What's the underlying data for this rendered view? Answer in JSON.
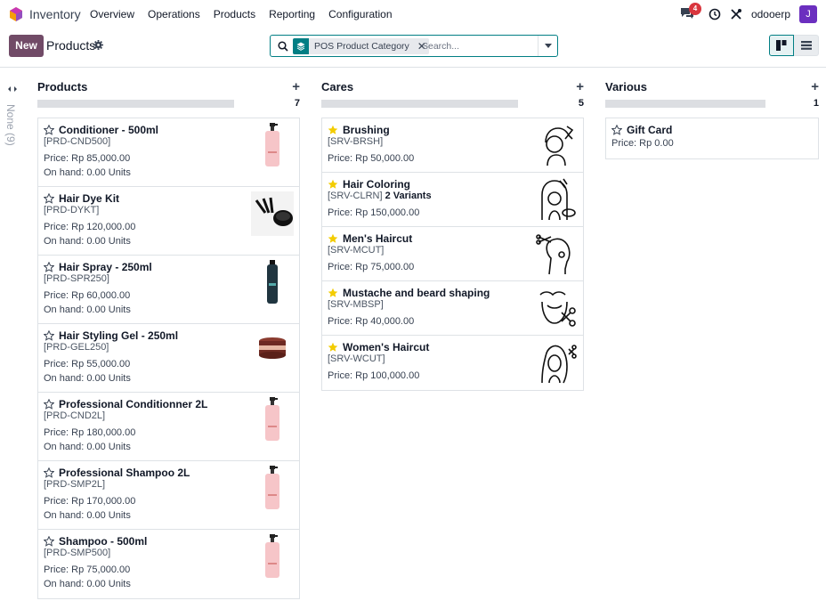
{
  "nav": {
    "app_name": "Inventory",
    "menu": [
      "Overview",
      "Operations",
      "Products",
      "Reporting",
      "Configuration"
    ],
    "message_count": "4",
    "db_name": "odooerp",
    "avatar_letter": "J"
  },
  "control_panel": {
    "new_label": "New",
    "title": "Products",
    "facet_label": "POS Product Category",
    "search_placeholder": "Search..."
  },
  "folded_column": {
    "label": "None (9)"
  },
  "columns": [
    {
      "title": "Products",
      "count": "7",
      "cards": [
        {
          "name": "Conditioner - 500ml",
          "code": "[PRD-CND500]",
          "price": "Price: Rp 85,000.00",
          "onhand": "On hand: 0.00 Units",
          "starred": false,
          "thumb": "bottle"
        },
        {
          "name": "Hair Dye Kit",
          "code": "[PRD-DYKT]",
          "price": "Price: Rp 120,000.00",
          "onhand": "On hand: 0.00 Units",
          "starred": false,
          "thumb": "dyekit"
        },
        {
          "name": "Hair Spray - 250ml",
          "code": "[PRD-SPR250]",
          "price": "Price: Rp 60,000.00",
          "onhand": "On hand: 0.00 Units",
          "starred": false,
          "thumb": "spray"
        },
        {
          "name": "Hair Styling Gel - 250ml",
          "code": "[PRD-GEL250]",
          "price": "Price: Rp 55,000.00",
          "onhand": "On hand: 0.00 Units",
          "starred": false,
          "thumb": "gel"
        },
        {
          "name": "Professional Conditionner 2L",
          "code": "[PRD-CND2L]",
          "price": "Price: Rp 180,000.00",
          "onhand": "On hand: 0.00 Units",
          "starred": false,
          "thumb": "bottle"
        },
        {
          "name": "Professional Shampoo 2L",
          "code": "[PRD-SMP2L]",
          "price": "Price: Rp 170,000.00",
          "onhand": "On hand: 0.00 Units",
          "starred": false,
          "thumb": "bottle"
        },
        {
          "name": "Shampoo - 500ml",
          "code": "[PRD-SMP500]",
          "price": "Price: Rp 75,000.00",
          "onhand": "On hand: 0.00 Units",
          "starred": false,
          "thumb": "bottle"
        }
      ]
    },
    {
      "title": "Cares",
      "count": "5",
      "cards": [
        {
          "name": "Brushing",
          "code": "[SRV-BRSH]",
          "variants": "",
          "price": "Price: Rp 50,000.00",
          "starred": true,
          "thumb": "brushing"
        },
        {
          "name": "Hair Coloring",
          "code": "[SRV-CLRN]",
          "variants": "2 Variants",
          "price": "Price: Rp 150,000.00",
          "starred": true,
          "thumb": "coloring"
        },
        {
          "name": "Men's Haircut",
          "code": "[SRV-MCUT]",
          "variants": "",
          "price": "Price: Rp 75,000.00",
          "starred": true,
          "thumb": "menhair"
        },
        {
          "name": "Mustache and beard shaping",
          "code": "[SRV-MBSP]",
          "variants": "",
          "price": "Price: Rp 40,000.00",
          "starred": true,
          "thumb": "beard"
        },
        {
          "name": "Women's Haircut",
          "code": "[SRV-WCUT]",
          "variants": "",
          "price": "Price: Rp 100,000.00",
          "starred": true,
          "thumb": "womenhair"
        }
      ]
    },
    {
      "title": "Various",
      "count": "1",
      "cards": [
        {
          "name": "Gift Card",
          "code": "",
          "variants": "",
          "price": "Price: Rp 0.00",
          "starred": false,
          "thumb": ""
        }
      ]
    }
  ],
  "colors": {
    "brand": "#714b67",
    "accent": "#017e84",
    "star": "#f3cc00",
    "badge": "#d9363e",
    "avatar": "#6b2fbf"
  }
}
